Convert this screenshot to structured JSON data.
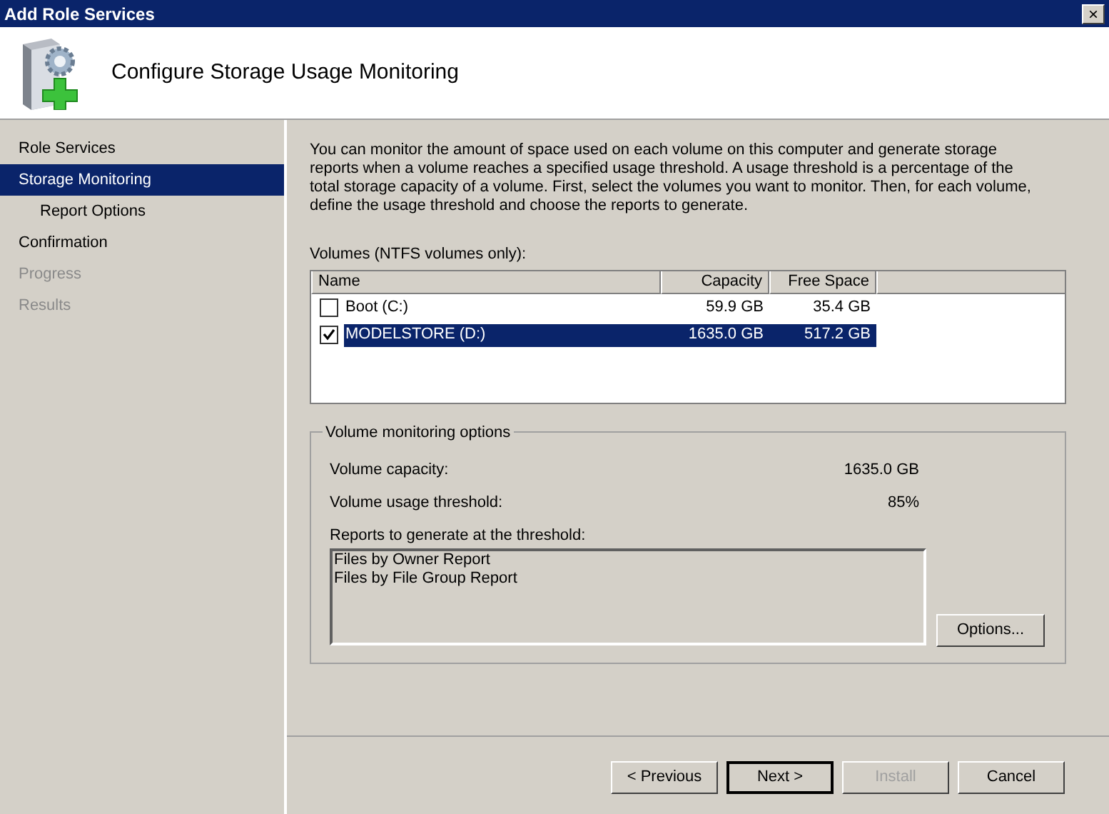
{
  "window": {
    "title": "Add Role Services",
    "close": "×"
  },
  "header": {
    "title": "Configure Storage Usage Monitoring"
  },
  "sidebar": {
    "items": [
      {
        "label": "Role Services",
        "selected": false,
        "disabled": false
      },
      {
        "label": "Storage Monitoring",
        "selected": true,
        "disabled": false,
        "children": [
          {
            "label": "Report Options",
            "selected": false,
            "disabled": false
          }
        ]
      },
      {
        "label": "Confirmation",
        "selected": false,
        "disabled": false
      },
      {
        "label": "Progress",
        "selected": false,
        "disabled": true
      },
      {
        "label": "Results",
        "selected": false,
        "disabled": true
      }
    ]
  },
  "description": "You can monitor the amount of space used on each volume on this computer and generate storage reports when a volume reaches a specified usage threshold.  A usage threshold is a percentage of the total storage capacity of a volume. First, select the volumes you want to monitor.  Then, for each volume, define the usage threshold and choose the reports to generate.",
  "volumes": {
    "label": "Volumes (NTFS volumes only):",
    "columns": [
      "Name",
      "Capacity",
      "Free Space"
    ],
    "rows": [
      {
        "name": "Boot (C:)",
        "capacity": "59.9 GB",
        "free": "35.4 GB",
        "checked": false,
        "selected": false
      },
      {
        "name": "MODELSTORE (D:)",
        "capacity": "1635.0 GB",
        "free": "517.2 GB",
        "checked": true,
        "selected": true
      }
    ]
  },
  "options": {
    "legend": "Volume monitoring options",
    "capacity_label": "Volume capacity:",
    "capacity": "1635.0 GB",
    "threshold_label": "Volume usage threshold:",
    "threshold": "85%",
    "reports_label": "Reports to generate at the threshold:",
    "reports": [
      "Files by Owner Report",
      "Files by File Group Report"
    ],
    "button": "Options..."
  },
  "buttons": [
    {
      "label": "< Previous",
      "default": false,
      "disabled": false
    },
    {
      "label": "Next >",
      "default": true,
      "disabled": false
    },
    {
      "label": "Install",
      "default": false,
      "disabled": true
    },
    {
      "label": "Cancel",
      "default": false,
      "disabled": false
    }
  ]
}
